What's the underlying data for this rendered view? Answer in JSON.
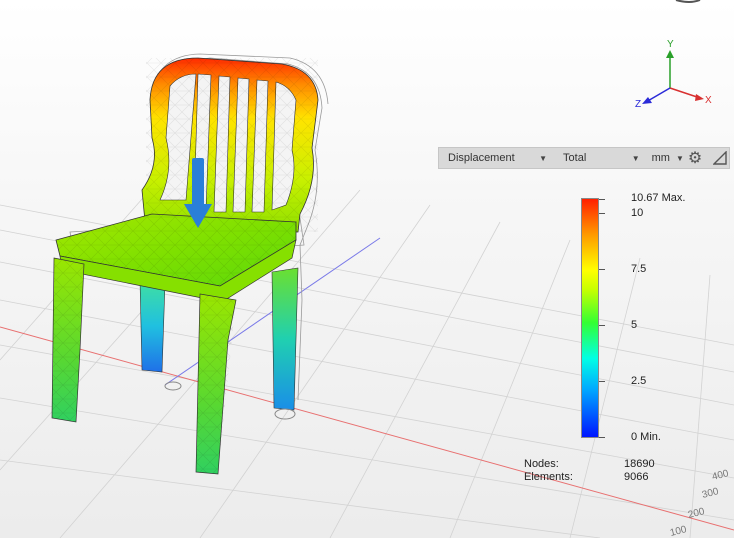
{
  "toolbar": {
    "result_type": "Displacement",
    "component": "Total",
    "unit": "mm",
    "settings_icon": "gear-icon",
    "expand_icon": "corner-triangle-icon"
  },
  "legend": {
    "max_label": "10.67 Max.",
    "ticks": [
      "10",
      "7.5",
      "5",
      "2.5"
    ],
    "min_label": "0 Min.",
    "colors": [
      "#0015ff",
      "#00a8ff",
      "#00ffe5",
      "#33ff33",
      "#ffff00",
      "#ff9a00",
      "#ff2000"
    ]
  },
  "stats": {
    "nodes_label": "Nodes:",
    "nodes_value": "18690",
    "elements_label": "Elements:",
    "elements_value": "9066"
  },
  "view_cube": {
    "x_label": "X",
    "y_label": "Y",
    "z_label": "Z"
  },
  "ground_labels": [
    "400",
    "300",
    "200",
    "100"
  ],
  "load_arrow_color": "#2a7fd8"
}
